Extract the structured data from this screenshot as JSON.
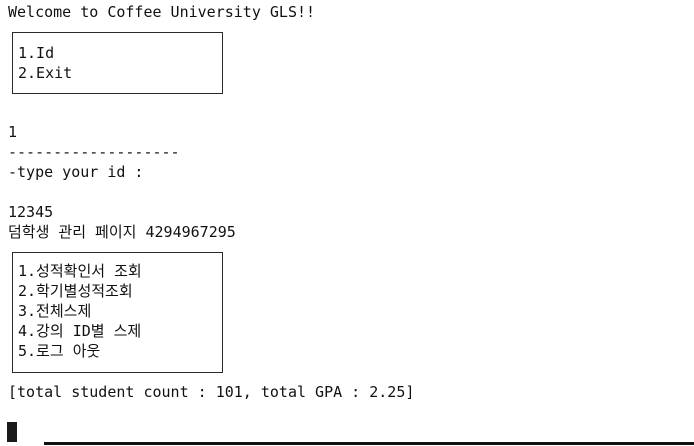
{
  "welcome": "Welcome to Coffee University GLS!!",
  "main_menu": {
    "items": [
      "1.Id",
      "2.Exit"
    ]
  },
  "input_choice": "1",
  "separator": "-------------------",
  "id_prompt": "-type your id :",
  "id_value": "12345",
  "page_title": "덤학생 관리 페이지 4294967295",
  "student_menu": {
    "items": [
      "1.성적확인서 조회",
      "2.학기별성적조회",
      "3.전체스제",
      "4.강의 ID별 스제",
      "5.로그 아웃"
    ]
  },
  "status_line": "[total student count : 101, total GPA : 2.25]"
}
